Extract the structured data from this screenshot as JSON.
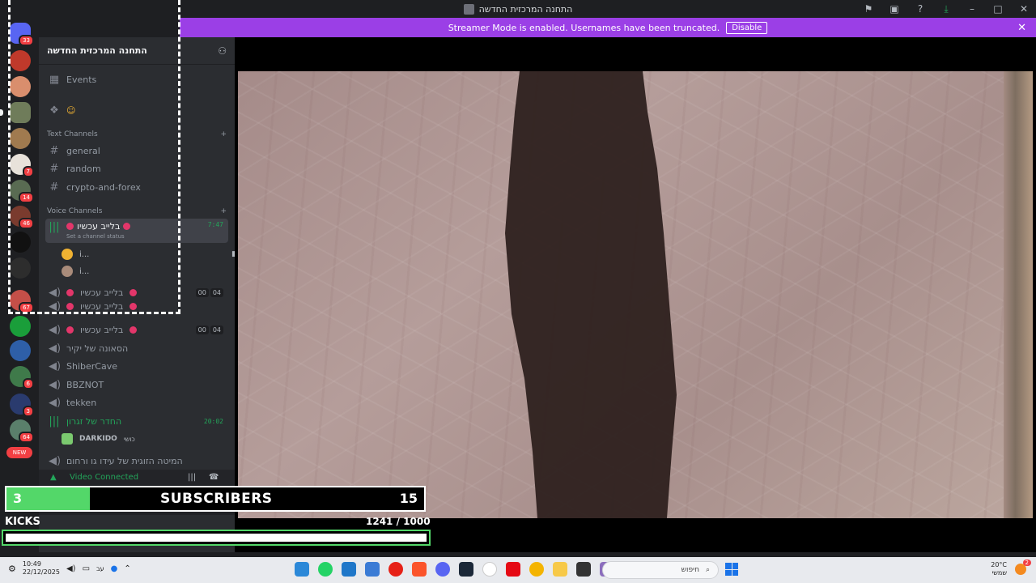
{
  "window": {
    "title": "התחנה המרכזית החדשה"
  },
  "banner": {
    "message": "Streamer Mode is enabled. Usernames have been truncated.",
    "disable_label": "Disable"
  },
  "rail": {
    "badges": [
      "33",
      "7",
      "14",
      "46",
      "67",
      "6",
      "3",
      "64",
      "NEW"
    ]
  },
  "sidebar": {
    "guild_name": "התחנה המרכזית החדשה",
    "events_label": "Events",
    "text_category": "Text Channels",
    "text_channels": [
      "general",
      "random",
      "crypto-and-forex"
    ],
    "voice_category": "Voice Channels",
    "voice_active": {
      "name": "בלייב עכשיו",
      "status": "Set a channel status",
      "time": "7:47"
    },
    "voice_users": [
      "i...",
      "i..."
    ],
    "voice_channels": [
      {
        "name": "בלייב עכשיו",
        "c1": "00",
        "c2": "04"
      },
      {
        "name": "בלייב עכשיו",
        "c1": "",
        "c2": ""
      },
      {
        "name": "בלייב עכשיו",
        "c1": "00",
        "c2": "04"
      },
      {
        "name": "הסאונה של יקיר"
      },
      {
        "name": "ShiberCave"
      },
      {
        "name": "BBZNOT"
      },
      {
        "name": "tekken"
      }
    ],
    "green_channel": {
      "name": "החדר של זגרון",
      "time": "20:02"
    },
    "green_user": {
      "name": "DARKIDO",
      "tag": "כושי"
    },
    "last_channel": "המיטה הזוגית של עידו גו ורחום",
    "video_connected": "Video Connected"
  },
  "overlay": {
    "subscribers_current": "3",
    "subscribers_label": "SUBSCRIBERS",
    "subscribers_goal": "15",
    "subscribers_progress": 0.2,
    "kicks_label": "KICKS",
    "kicks_count": "1241",
    "kicks_goal": "/ 1000",
    "kicks_progress": 1.0
  },
  "taskbar": {
    "time": "10:49",
    "date": "22/12/2025",
    "lang": "עב",
    "search_placeholder": "חיפוש",
    "weather_temp": "20°C",
    "weather_desc": "שמשי",
    "notification_count": "2"
  },
  "colors": {
    "accent": "#9b3fe6",
    "voice_green": "#23a55a",
    "goal_green": "#53d769"
  }
}
